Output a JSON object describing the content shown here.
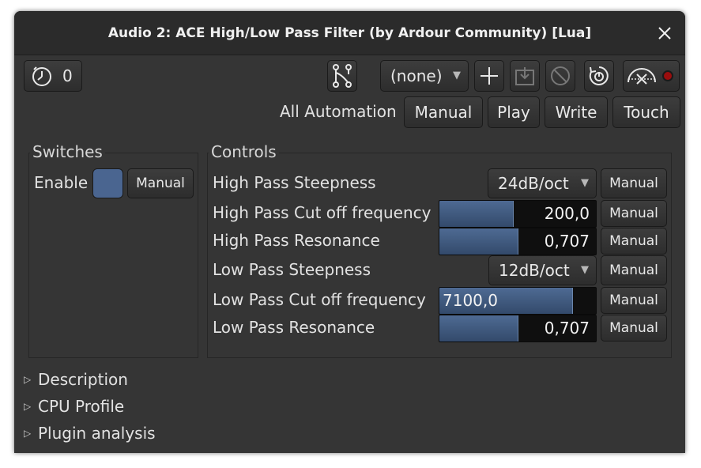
{
  "window": {
    "title": "Audio 2: ACE High/Low Pass Filter (by Ardour Community) [Lua]"
  },
  "toolbar": {
    "latency_value": "0",
    "preset_selected": "(none)",
    "automation_label": "All Automation",
    "automation_buttons": [
      "Manual",
      "Play",
      "Write",
      "Touch"
    ]
  },
  "switches": {
    "title": "Switches",
    "enable_label": "Enable",
    "enable_mode": "Manual",
    "enable_color": "#4a6590"
  },
  "controls": {
    "title": "Controls",
    "rows": [
      {
        "label": "High Pass Steepness",
        "value": "24dB/oct",
        "mode": "Manual"
      },
      {
        "label": "High Pass Cut off frequency",
        "value": "200,0",
        "fill": 0.47,
        "mode": "Manual"
      },
      {
        "label": "High Pass Resonance",
        "value": "0,707",
        "fill": 0.5,
        "mode": "Manual"
      },
      {
        "label": "Low Pass Steepness",
        "value": "12dB/oct",
        "mode": "Manual"
      },
      {
        "label": "Low Pass Cut off frequency",
        "value": "7100,0",
        "fill": 0.85,
        "mode": "Manual"
      },
      {
        "label": "Low Pass Resonance",
        "value": "0,707",
        "fill": 0.5,
        "mode": "Manual"
      }
    ]
  },
  "sections": [
    "Description",
    "CPU Profile",
    "Plugin analysis"
  ],
  "colors": {
    "window_bg": "#353535",
    "titlebar_bg": "#2b2b2b",
    "slider_fill": "#3f5a80",
    "record_led": "#b01010"
  }
}
